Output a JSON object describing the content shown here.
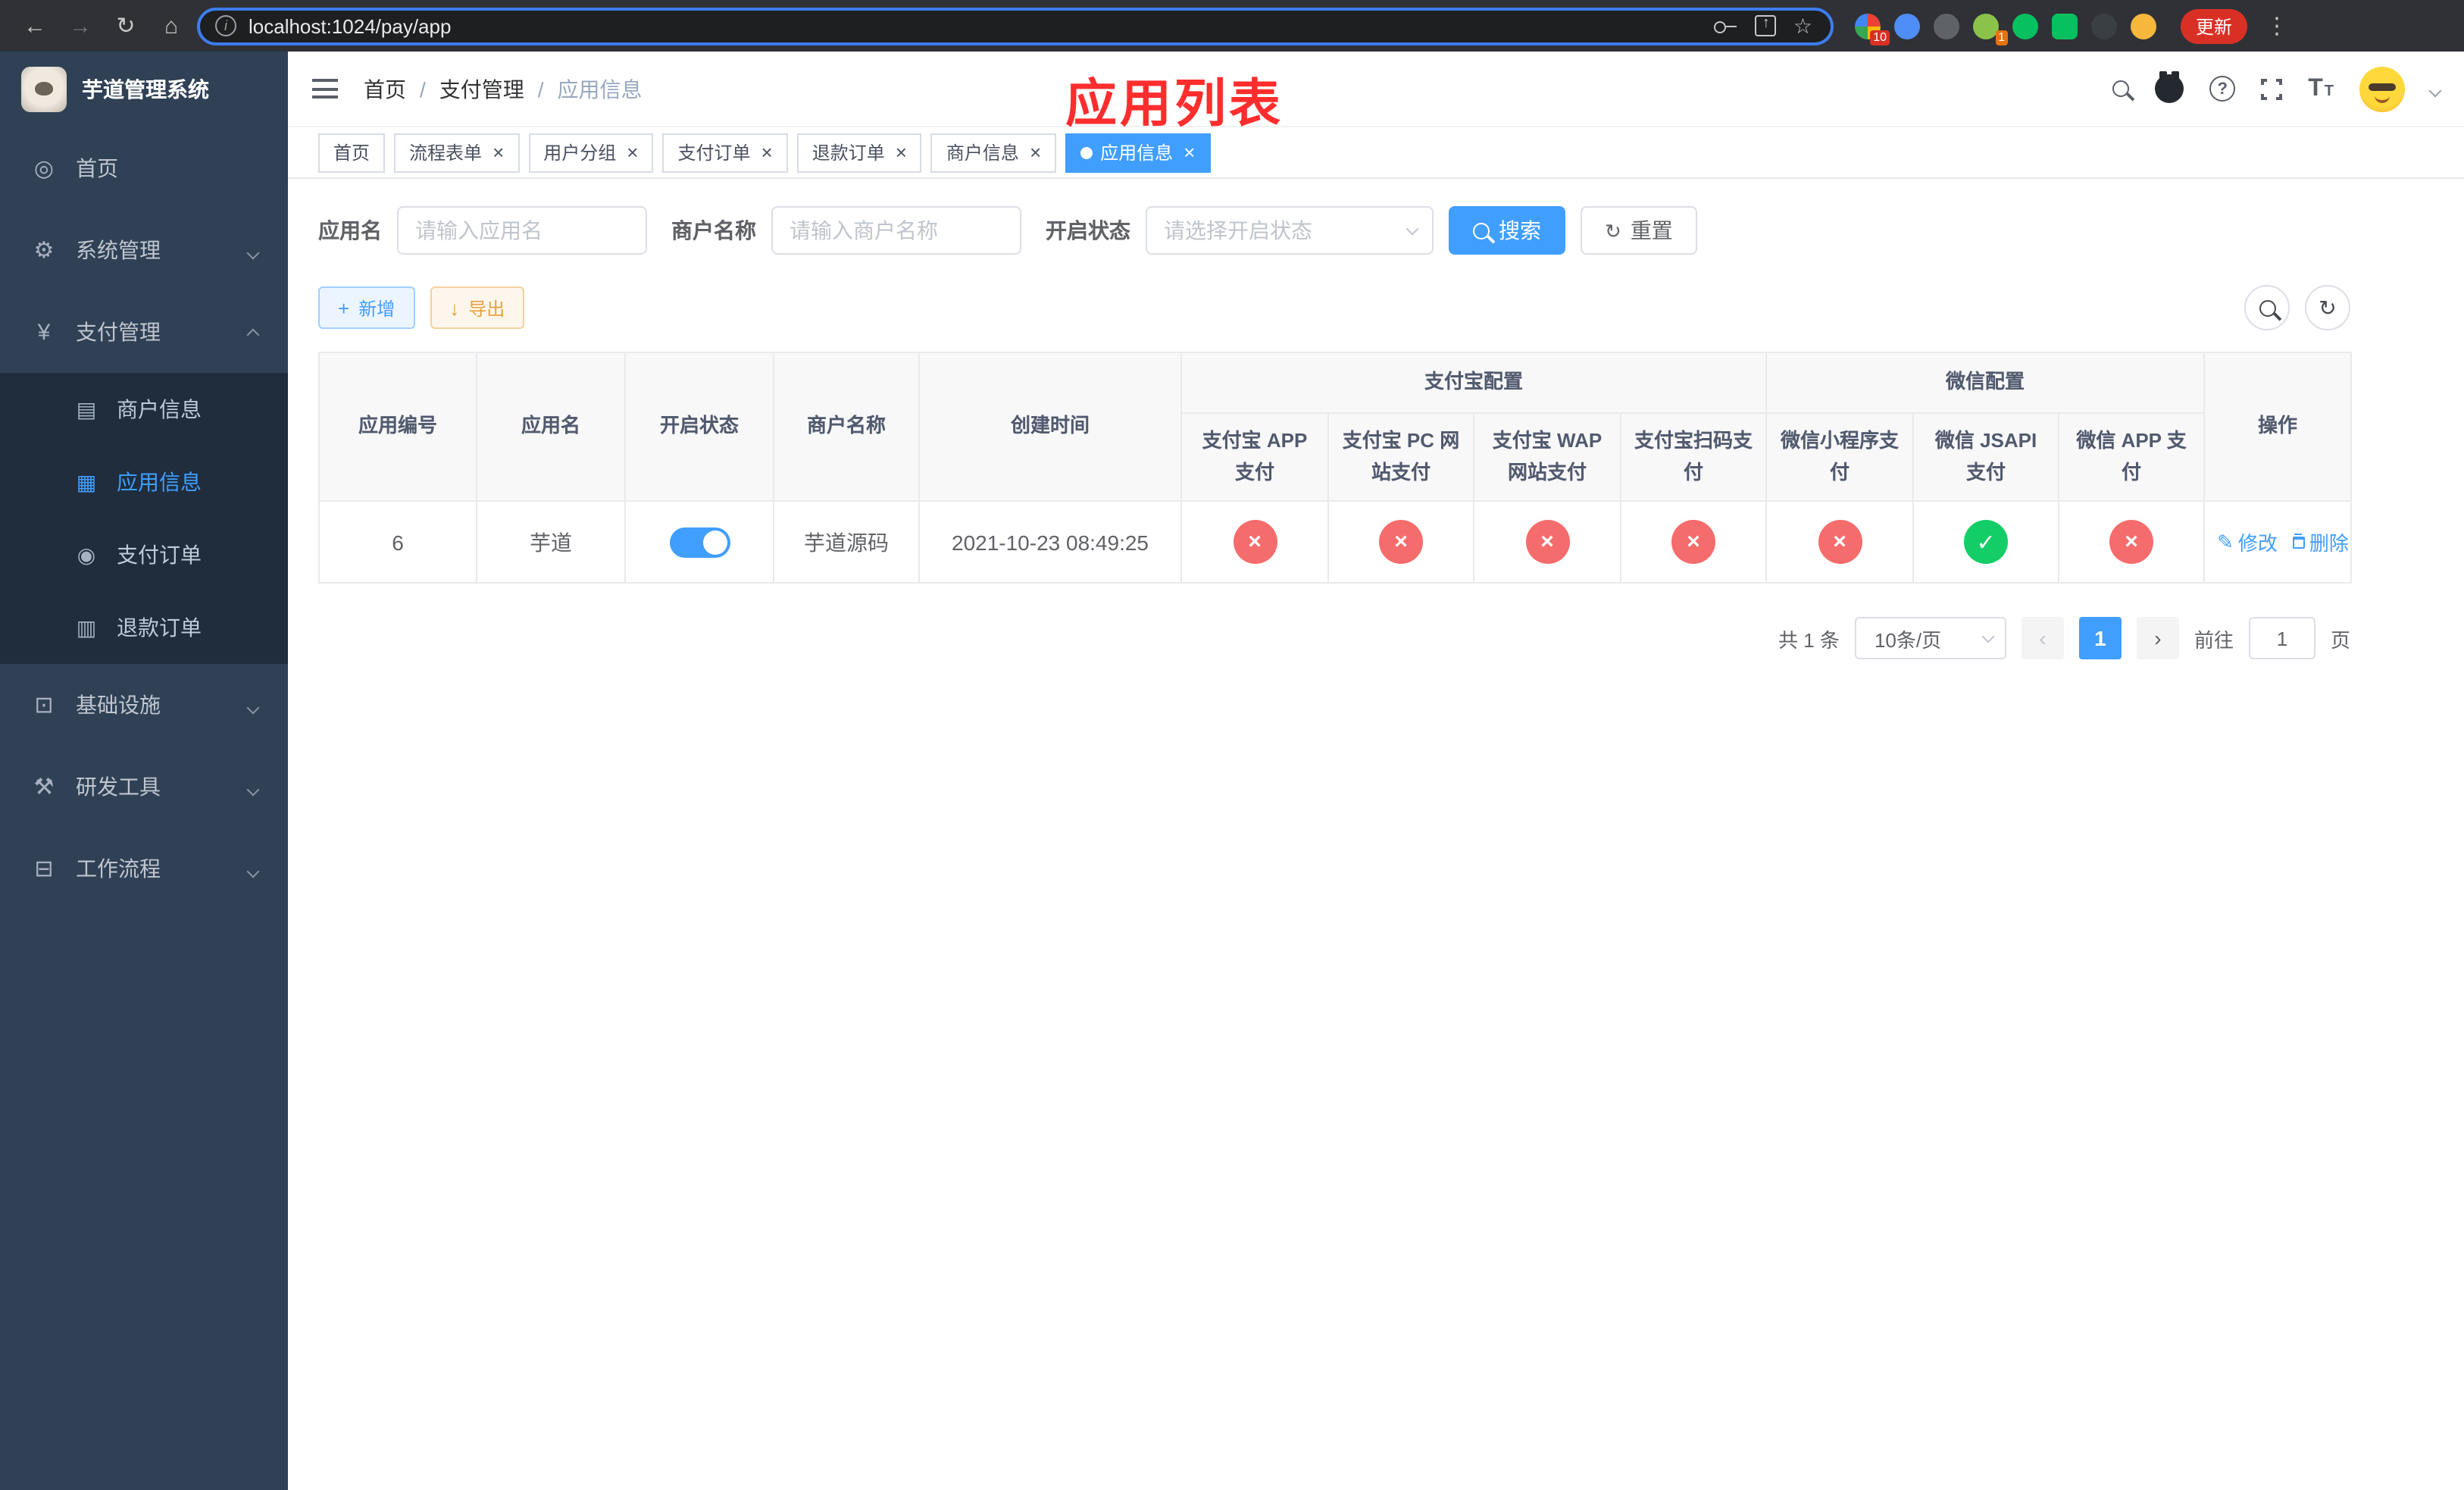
{
  "colors": {
    "primary": "#409eff",
    "success": "#13ce66",
    "danger": "#f56c6c",
    "warning": "#e6a23c",
    "overlay_title": "#ff2d2d",
    "sidebar_bg": "#304156",
    "submenu_bg": "#1f2d3d"
  },
  "browser": {
    "url": "localhost:1024/pay/app",
    "update_label": "更新",
    "ext_badge_a": "10",
    "ext_badge_b": "1"
  },
  "icons": {
    "back": "←",
    "forward": "→",
    "reload": "↻",
    "home": "⌂",
    "info": "i",
    "share_arrow": "↑",
    "bookmark": "☆",
    "menu_dots": "⋮",
    "question": "?",
    "slash": "/",
    "plus": "+",
    "download": "↓",
    "refresh": "↻",
    "close": "×",
    "cross": "×",
    "check": "✓",
    "edit": "✎",
    "prev": "‹",
    "next": "›",
    "letter_T": "T",
    "dashboard": "◎",
    "gear": "⚙",
    "yen": "¥",
    "card": "▤",
    "grid": "▦",
    "coin": "◉",
    "doc": "▥",
    "infra": "⊡",
    "tools": "⚒",
    "workflow": "⊟"
  },
  "sidebar": {
    "title": "芋道管理系统",
    "home": "首页",
    "system": "系统管理",
    "payment": "支付管理",
    "merchant": "商户信息",
    "app": "应用信息",
    "pay_order": "支付订单",
    "refund_order": "退款订单",
    "infra": "基础设施",
    "dev": "研发工具",
    "workflow": "工作流程"
  },
  "header": {
    "crumb_home": "首页",
    "crumb_section": "支付管理",
    "crumb_current": "应用信息",
    "overlay_title": "应用列表"
  },
  "tabs": [
    {
      "label": "首页"
    },
    {
      "label": "流程表单"
    },
    {
      "label": "用户分组"
    },
    {
      "label": "支付订单"
    },
    {
      "label": "退款订单"
    },
    {
      "label": "商户信息"
    },
    {
      "label": "应用信息"
    }
  ],
  "filters": {
    "app_name_label": "应用名",
    "app_name_placeholder": "请输入应用名",
    "merchant_label": "商户名称",
    "merchant_placeholder": "请输入商户名称",
    "status_label": "开启状态",
    "status_placeholder": "请选择开启状态",
    "search": "搜索",
    "reset": "重置"
  },
  "toolbar": {
    "add": "新增",
    "export": "导出"
  },
  "table": {
    "headers": {
      "app_id": "应用编号",
      "app_name": "应用名",
      "status": "开启状态",
      "merchant": "商户名称",
      "created": "创建时间",
      "alipay_group": "支付宝配置",
      "wechat_group": "微信配置",
      "alipay_app": "支付宝 APP 支付",
      "alipay_pc": "支付宝 PC 网站支付",
      "alipay_wap": "支付宝 WAP 网站支付",
      "alipay_qr": "支付宝扫码支付",
      "wx_mini": "微信小程序支付",
      "wx_jsapi": "微信 JSAPI 支付",
      "wx_app": "微信 APP 支付",
      "actions": "操作"
    },
    "rows": [
      {
        "app_id": "6",
        "app_name": "芋道",
        "enabled": "on",
        "merchant": "芋道源码",
        "created": "2021-10-23 08:49:25",
        "channels": [
          "no",
          "no",
          "no",
          "no",
          "no",
          "yes",
          "no"
        ],
        "edit": "修改",
        "delete": "删除"
      }
    ]
  },
  "pagination": {
    "total": "共 1 条",
    "page_size": "10条/页",
    "page": "1",
    "goto_label": "前往",
    "goto_value": "1",
    "page_unit": "页"
  }
}
